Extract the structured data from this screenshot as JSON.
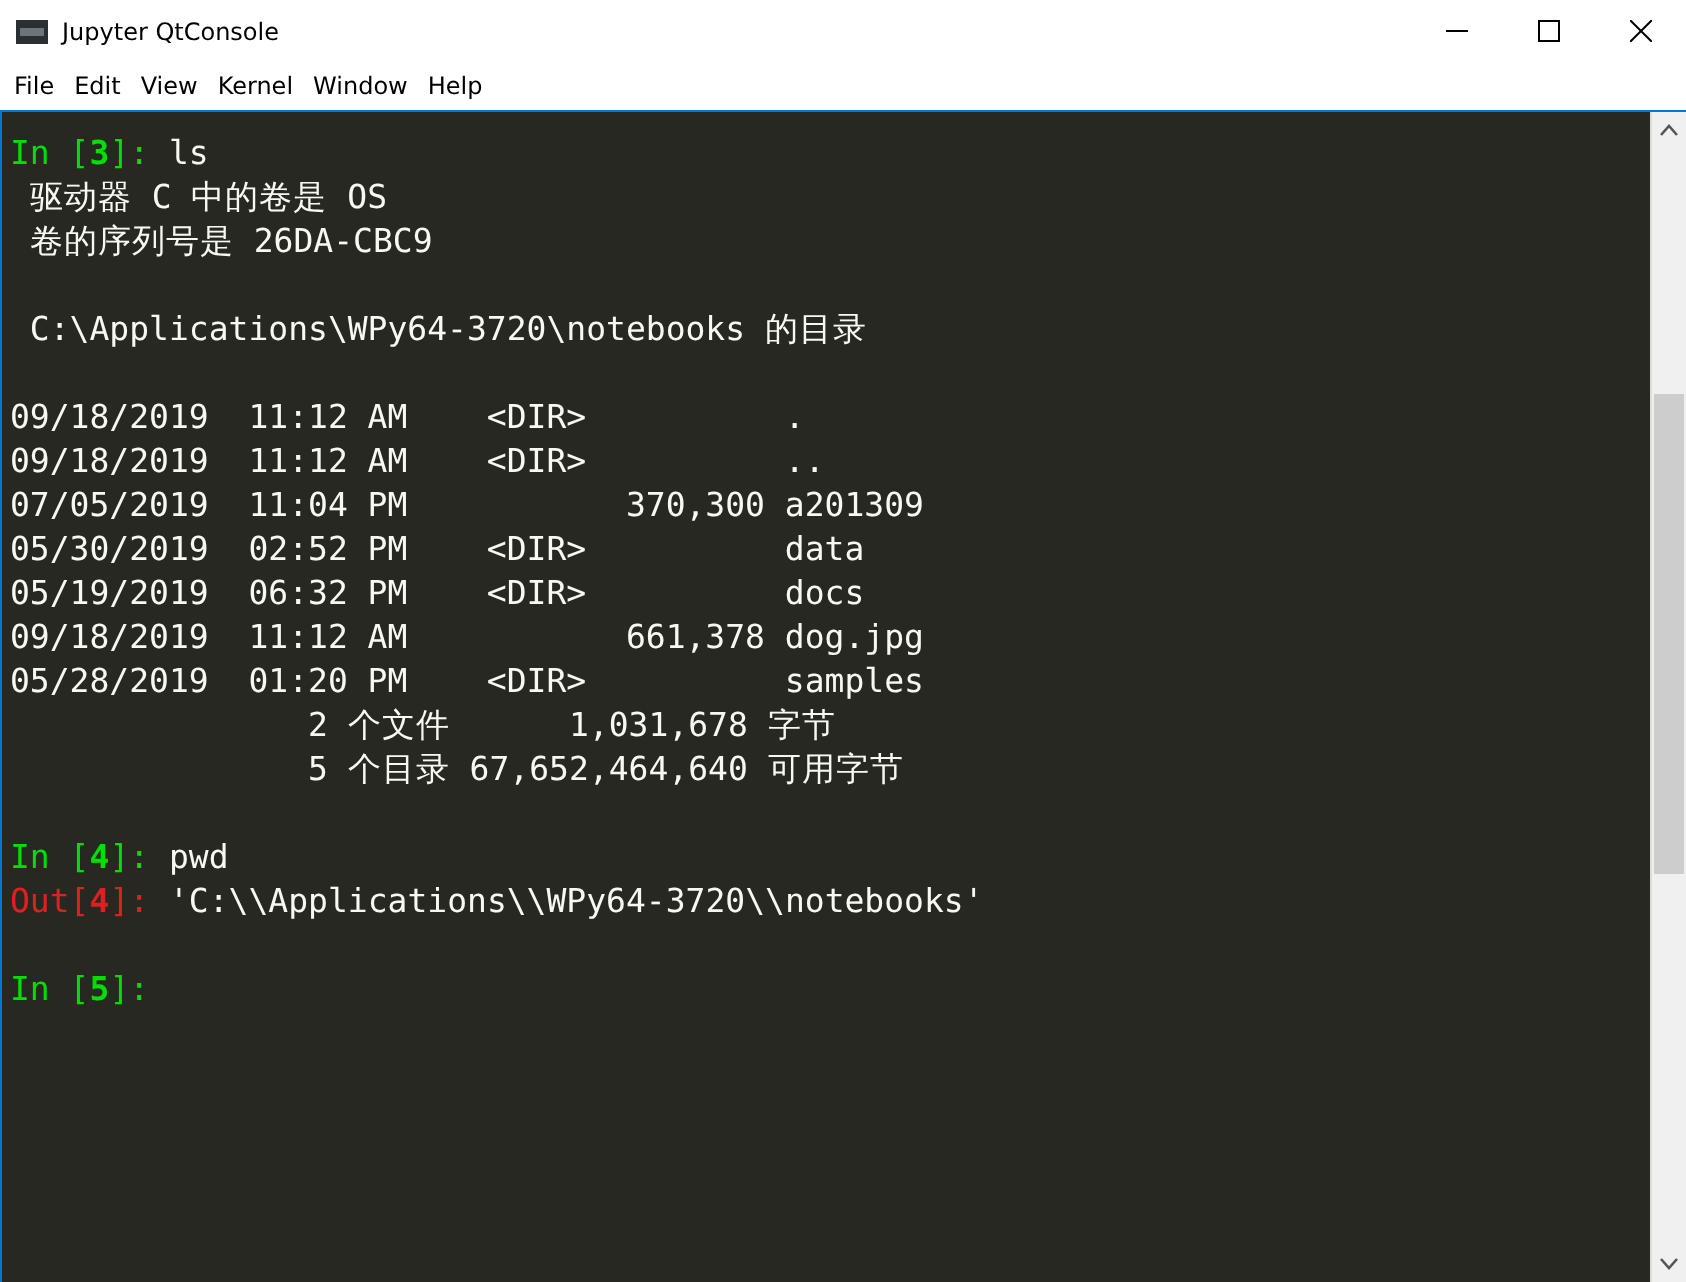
{
  "window": {
    "title": "Jupyter QtConsole"
  },
  "menu": [
    "File",
    "Edit",
    "View",
    "Kernel",
    "Window",
    "Help"
  ],
  "console": [
    {
      "kind": "in",
      "prefix": "In [",
      "number": "3",
      "suffix": "]: ",
      "code": "ls"
    },
    {
      "kind": "text",
      "text": " 驱动器 C 中的卷是 OS"
    },
    {
      "kind": "text",
      "text": " 卷的序列号是 26DA-CBC9"
    },
    {
      "kind": "blank"
    },
    {
      "kind": "text",
      "text": " C:\\Applications\\WPy64-3720\\notebooks 的目录"
    },
    {
      "kind": "blank"
    },
    {
      "kind": "text",
      "text": "09/18/2019  11:12 AM    <DIR>          ."
    },
    {
      "kind": "text",
      "text": "09/18/2019  11:12 AM    <DIR>          .."
    },
    {
      "kind": "text",
      "text": "07/05/2019  11:04 PM           370,300 a201309"
    },
    {
      "kind": "text",
      "text": "05/30/2019  02:52 PM    <DIR>          data"
    },
    {
      "kind": "text",
      "text": "05/19/2019  06:32 PM    <DIR>          docs"
    },
    {
      "kind": "text",
      "text": "09/18/2019  11:12 AM           661,378 dog.jpg"
    },
    {
      "kind": "text",
      "text": "05/28/2019  01:20 PM    <DIR>          samples"
    },
    {
      "kind": "text",
      "text": "               2 个文件      1,031,678 字节"
    },
    {
      "kind": "text",
      "text": "               5 个目录 67,652,464,640 可用字节"
    },
    {
      "kind": "blank"
    },
    {
      "kind": "in",
      "prefix": "In [",
      "number": "4",
      "suffix": "]: ",
      "code": "pwd"
    },
    {
      "kind": "out",
      "prefix": "Out[",
      "number": "4",
      "suffix": "]: ",
      "code": "'C:\\\\Applications\\\\WPy64-3720\\\\notebooks'"
    },
    {
      "kind": "blank"
    },
    {
      "kind": "in",
      "prefix": "In [",
      "number": "5",
      "suffix": "]:"
    }
  ]
}
